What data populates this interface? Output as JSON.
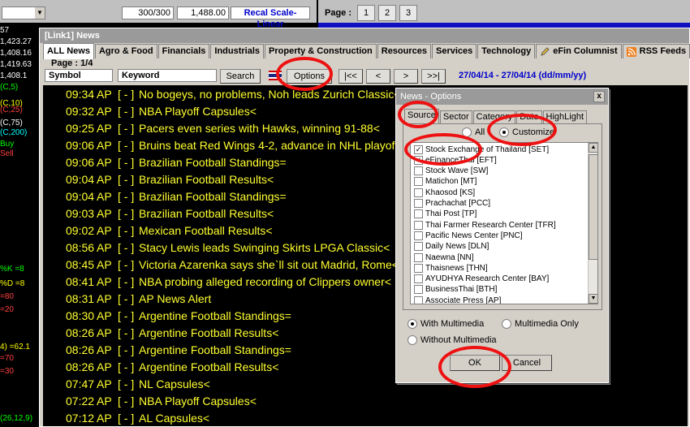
{
  "background": {
    "ratio": "300/300",
    "price": "1,488.00",
    "recal_label": "Recal Scale-Linear",
    "page_label": "Page :",
    "pages": [
      "1",
      "2",
      "3"
    ],
    "left_values": [
      {
        "text": "57",
        "color": "#ffffff"
      },
      {
        "text": "1,423.27",
        "color": "#ffffff"
      },
      {
        "text": "1,408.16",
        "color": "#ffffff"
      },
      {
        "text": "1,419.63",
        "color": "#ffffff"
      },
      {
        "text": "1,408.1",
        "color": "#ffffff"
      },
      {
        "text": "(C,5)",
        "color": "#00ff00"
      },
      {
        "text": "(C,10)",
        "color": "#ffff00"
      },
      {
        "text": "(C,25)",
        "color": "#ff4040"
      },
      {
        "text": "(C,75)",
        "color": "#ffffff"
      },
      {
        "text": "(C,200)",
        "color": "#00ffff"
      },
      {
        "text": "Buy",
        "color": "#00ff00"
      },
      {
        "text": "Sell",
        "color": "#ff4040"
      },
      {
        "text": "%K =8",
        "color": "#00ff00"
      },
      {
        "text": "%D =8",
        "color": "#ffff00"
      },
      {
        "text": "=80",
        "color": "#ff4040"
      },
      {
        "text": "=20",
        "color": "#ff4040"
      },
      {
        "text": "4) =62.1",
        "color": "#ffff00"
      },
      {
        "text": "=70",
        "color": "#ff4040"
      },
      {
        "text": "=30",
        "color": "#ff4040"
      },
      {
        "text": "(26,12,9)",
        "color": "#00ff00"
      }
    ]
  },
  "window": {
    "title": "[Link1] News",
    "tabs": [
      {
        "label": "ALL News",
        "active": true
      },
      {
        "label": "Agro & Food"
      },
      {
        "label": "Financials"
      },
      {
        "label": "Industrials"
      },
      {
        "label": "Property & Construction"
      },
      {
        "label": "Resources"
      },
      {
        "label": "Services"
      },
      {
        "label": "Technology"
      },
      {
        "label": "eFin Columnist",
        "icon": "pencil-icon"
      },
      {
        "label": "RSS Feeds",
        "icon": "rss-icon"
      }
    ],
    "page_info": "Page : 1/4",
    "symbol_label": "Symbol",
    "keyword_label": "Keyword",
    "search_label": "Search",
    "options_label": "Options",
    "nav": [
      "|<<",
      "<",
      ">",
      ">>|"
    ],
    "date_range": "27/04/14 - 27/04/14 (dd/mm/yy)"
  },
  "news": [
    {
      "time": "09:34",
      "src": "AP",
      "flag": "[ - ]",
      "headline": "No bogeys, no problems, Noh leads Zurich Classic<"
    },
    {
      "time": "09:32",
      "src": "AP",
      "flag": "[ - ]",
      "headline": "NBA Playoff Capsules<"
    },
    {
      "time": "09:25",
      "src": "AP",
      "flag": "[ - ]",
      "headline": "Pacers even series with Hawks, winning 91-88<"
    },
    {
      "time": "09:06",
      "src": "AP",
      "flag": "[ - ]",
      "headline": "Bruins beat Red Wings 4-2, advance in NHL playoff"
    },
    {
      "time": "09:06",
      "src": "AP",
      "flag": "[ - ]",
      "headline": "Brazilian Football Standings="
    },
    {
      "time": "09:04",
      "src": "AP",
      "flag": "[ - ]",
      "headline": "Brazilian Football Results<"
    },
    {
      "time": "09:04",
      "src": "AP",
      "flag": "[ - ]",
      "headline": "Brazilian Football Standings="
    },
    {
      "time": "09:03",
      "src": "AP",
      "flag": "[ - ]",
      "headline": "Brazilian Football Results<"
    },
    {
      "time": "09:02",
      "src": "AP",
      "flag": "[ - ]",
      "headline": "Mexican Football Results<"
    },
    {
      "time": "08:56",
      "src": "AP",
      "flag": "[ - ]",
      "headline": "Stacy Lewis leads Swinging Skirts LPGA Classic<"
    },
    {
      "time": "08:45",
      "src": "AP",
      "flag": "[ - ]",
      "headline": "Victoria Azarenka says she`ll sit out Madrid, Rome<"
    },
    {
      "time": "08:41",
      "src": "AP",
      "flag": "[ - ]",
      "headline": "NBA probing alleged recording of Clippers owner<"
    },
    {
      "time": "08:31",
      "src": "AP",
      "flag": "[ - ]",
      "headline": "AP News Alert"
    },
    {
      "time": "08:30",
      "src": "AP",
      "flag": "[ - ]",
      "headline": "Argentine Football Standings="
    },
    {
      "time": "08:26",
      "src": "AP",
      "flag": "[ - ]",
      "headline": "Argentine Football Results<"
    },
    {
      "time": "08:26",
      "src": "AP",
      "flag": "[ - ]",
      "headline": "Argentine Football Standings="
    },
    {
      "time": "08:26",
      "src": "AP",
      "flag": "[ - ]",
      "headline": "Argentine Football Results<"
    },
    {
      "time": "07:47",
      "src": "AP",
      "flag": "[ - ]",
      "headline": "NL Capsules<"
    },
    {
      "time": "07:22",
      "src": "AP",
      "flag": "[ - ]",
      "headline": "NBA Playoff Capsules<"
    },
    {
      "time": "07:12",
      "src": "AP",
      "flag": "[ - ]",
      "headline": "AL Capsules<"
    }
  ],
  "dialog": {
    "title": "News - Options",
    "close": "x",
    "tabs": [
      "Source",
      "Sector",
      "Category",
      "Date",
      "HighLight"
    ],
    "all_label": "All",
    "customize_label": "Customize",
    "selected_mode": "Customize",
    "sources": [
      {
        "label": "Stock Exchange of Thailand [SET]",
        "checked": true
      },
      {
        "label": "eFinanceThai [EFT]",
        "checked": true
      },
      {
        "label": "Stock Wave [SW]",
        "checked": false
      },
      {
        "label": "Matichon [MT]",
        "checked": false
      },
      {
        "label": "Khaosod [KS]",
        "checked": false
      },
      {
        "label": "Prachachat [PCC]",
        "checked": false
      },
      {
        "label": "Thai Post [TP]",
        "checked": false
      },
      {
        "label": "Thai Farmer Research Center [TFR]",
        "checked": false
      },
      {
        "label": "Pacific News Center [PNC]",
        "checked": false
      },
      {
        "label": "Daily News [DLN]",
        "checked": false
      },
      {
        "label": "Naewna [NN]",
        "checked": false
      },
      {
        "label": "Thaisnews [THN]",
        "checked": false
      },
      {
        "label": "AYUDHYA Research Center [BAY]",
        "checked": false
      },
      {
        "label": "BusinessThai [BTH]",
        "checked": false
      },
      {
        "label": "Associate Press [AP]",
        "checked": false
      }
    ],
    "with_multimedia": "With Multimedia",
    "multimedia_only": "Multimedia Only",
    "without_multimedia": "Without Multimedia",
    "ok_label": "OK",
    "cancel_label": "Cancel"
  },
  "colors": {
    "news_text": "#ffff30",
    "annotation": "#ee1111",
    "date_range": "#0000cc"
  }
}
